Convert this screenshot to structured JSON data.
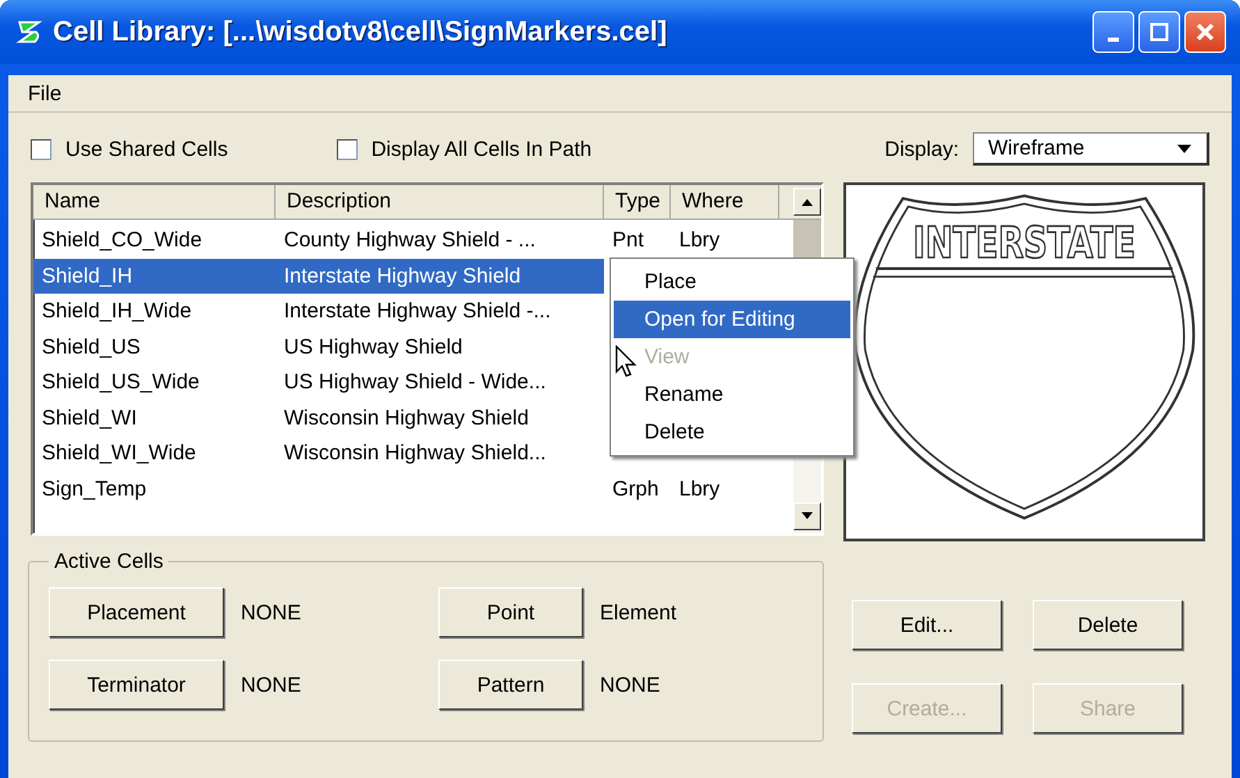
{
  "window": {
    "title": "Cell Library: [...\\wisdotv8\\cell\\SignMarkers.cel]"
  },
  "menu": [
    "File"
  ],
  "options": [
    {
      "label": "Use Shared Cells",
      "checked": false
    },
    {
      "label": "Display All Cells In Path",
      "checked": false
    }
  ],
  "display": {
    "label": "Display:",
    "value": "Wireframe"
  },
  "table": {
    "columns": [
      "Name",
      "Description",
      "Type",
      "Where"
    ],
    "rows": [
      {
        "name": "Shield_CO_Wide",
        "description": "County Highway Shield - ...",
        "type": "Pnt",
        "where": "Lbry",
        "selected": false
      },
      {
        "name": "Shield_IH",
        "description": "Interstate Highway Shield",
        "selected": true
      },
      {
        "name": "Shield_IH_Wide",
        "description": "Interstate Highway Shield -...",
        "selected": false
      },
      {
        "name": "Shield_US",
        "description": "US Highway Shield",
        "selected": false
      },
      {
        "name": "Shield_US_Wide",
        "description": "US Highway Shield - Wide...",
        "selected": false
      },
      {
        "name": "Shield_WI",
        "description": "Wisconsin Highway Shield",
        "selected": false
      },
      {
        "name": "Shield_WI_Wide",
        "description": "Wisconsin Highway Shield...",
        "selected": false
      },
      {
        "name": "Sign_Temp",
        "description": "",
        "type": "Grph",
        "where": "Lbry",
        "selected": false
      }
    ]
  },
  "context_menu": [
    {
      "label": "Place",
      "selected": false,
      "disabled": false
    },
    {
      "label": "Open for Editing",
      "selected": true,
      "disabled": false
    },
    {
      "label": "View",
      "selected": false,
      "disabled": true
    },
    {
      "label": "Rename",
      "selected": false,
      "disabled": false
    },
    {
      "label": "Delete",
      "selected": false,
      "disabled": false
    }
  ],
  "preview": {
    "sign_text": "INTERSTATE"
  },
  "active_cells": {
    "title": "Active Cells",
    "items": [
      {
        "button": "Placement",
        "value": "NONE"
      },
      {
        "button": "Point",
        "value": "Element"
      },
      {
        "button": "Terminator",
        "value": "NONE"
      },
      {
        "button": "Pattern",
        "value": "NONE"
      }
    ]
  },
  "actions": [
    {
      "label": "Edit...",
      "disabled": false
    },
    {
      "label": "Delete",
      "disabled": false
    },
    {
      "label": "Create...",
      "disabled": true
    },
    {
      "label": "Share",
      "disabled": true
    }
  ]
}
